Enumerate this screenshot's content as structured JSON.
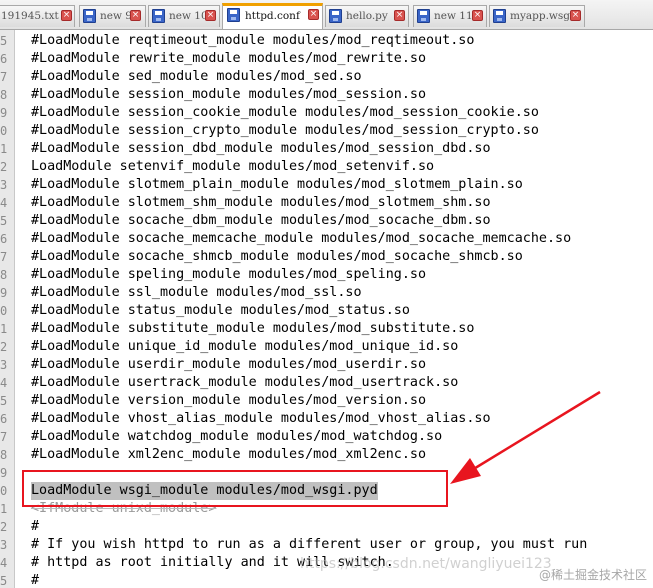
{
  "tabs": [
    {
      "label": "191945.txt",
      "active": false
    },
    {
      "label": "new 9",
      "active": false
    },
    {
      "label": "new 10",
      "active": false
    },
    {
      "label": "httpd.conf",
      "active": true
    },
    {
      "label": "hello.py",
      "active": false
    },
    {
      "label": "new 11",
      "active": false
    },
    {
      "label": "myapp.wsgi",
      "active": false
    }
  ],
  "editor": {
    "lines": [
      {
        "num": "5",
        "text": "#LoadModule reqtimeout_module modules/mod_reqtimeout.so"
      },
      {
        "num": "6",
        "text": "#LoadModule rewrite_module modules/mod_rewrite.so"
      },
      {
        "num": "7",
        "text": "#LoadModule sed_module modules/mod_sed.so"
      },
      {
        "num": "8",
        "text": "#LoadModule session_module modules/mod_session.so"
      },
      {
        "num": "9",
        "text": "#LoadModule session_cookie_module modules/mod_session_cookie.so"
      },
      {
        "num": "0",
        "text": "#LoadModule session_crypto_module modules/mod_session_crypto.so"
      },
      {
        "num": "1",
        "text": "#LoadModule session_dbd_module modules/mod_session_dbd.so"
      },
      {
        "num": "2",
        "text": "LoadModule setenvif_module modules/mod_setenvif.so"
      },
      {
        "num": "3",
        "text": "#LoadModule slotmem_plain_module modules/mod_slotmem_plain.so"
      },
      {
        "num": "4",
        "text": "#LoadModule slotmem_shm_module modules/mod_slotmem_shm.so"
      },
      {
        "num": "5",
        "text": "#LoadModule socache_dbm_module modules/mod_socache_dbm.so"
      },
      {
        "num": "6",
        "text": "#LoadModule socache_memcache_module modules/mod_socache_memcache.so"
      },
      {
        "num": "7",
        "text": "#LoadModule socache_shmcb_module modules/mod_socache_shmcb.so"
      },
      {
        "num": "8",
        "text": "#LoadModule speling_module modules/mod_speling.so"
      },
      {
        "num": "9",
        "text": "#LoadModule ssl_module modules/mod_ssl.so"
      },
      {
        "num": "0",
        "text": "#LoadModule status_module modules/mod_status.so"
      },
      {
        "num": "1",
        "text": "#LoadModule substitute_module modules/mod_substitute.so"
      },
      {
        "num": "2",
        "text": "#LoadModule unique_id_module modules/mod_unique_id.so"
      },
      {
        "num": "3",
        "text": "#LoadModule userdir_module modules/mod_userdir.so"
      },
      {
        "num": "4",
        "text": "#LoadModule usertrack_module modules/mod_usertrack.so"
      },
      {
        "num": "5",
        "text": "#LoadModule version_module modules/mod_version.so"
      },
      {
        "num": "6",
        "text": "#LoadModule vhost_alias_module modules/mod_vhost_alias.so"
      },
      {
        "num": "7",
        "text": "#LoadModule watchdog_module modules/mod_watchdog.so"
      },
      {
        "num": "8",
        "text": "#LoadModule xml2enc_module modules/mod_xml2enc.so"
      },
      {
        "num": "9",
        "text": ""
      },
      {
        "num": "0",
        "text": "LoadModule wsgi_module modules/mod_wsgi.pyd",
        "selected": true
      },
      {
        "num": "1",
        "text": "<IfModule unixd_module>",
        "dimmed": true
      },
      {
        "num": "2",
        "text": "#"
      },
      {
        "num": "3",
        "text": "# If you wish httpd to run as a different user or group, you must run"
      },
      {
        "num": "4",
        "text": "# httpd as root initially and it will switch."
      },
      {
        "num": "5",
        "text": "#"
      }
    ]
  },
  "annotations": {
    "box_color": "#e8151f",
    "arrow_color": "#e8151f",
    "watermark": "https://blog.csdn.net/wangliyuei123",
    "credit": "@稀土掘金技术社区"
  }
}
